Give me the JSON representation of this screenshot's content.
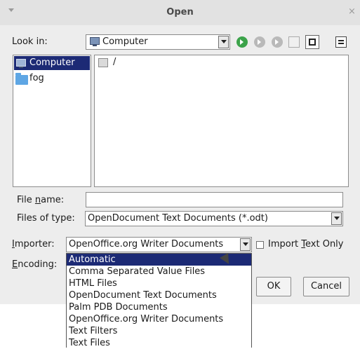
{
  "window": {
    "title": "Open",
    "close_glyph": "×"
  },
  "look_in": {
    "label": "Look in:",
    "value": "Computer",
    "toolbar": [
      "back-icon",
      "forward-icon",
      "up-icon",
      "new-folder-icon",
      "list-view-icon",
      "detail-view-icon"
    ]
  },
  "sidebar": {
    "items": [
      {
        "label": "Computer",
        "icon": "computer-icon",
        "selected": true
      },
      {
        "label": "fog",
        "icon": "folder-icon",
        "selected": false
      }
    ]
  },
  "files": {
    "items": [
      {
        "label": "/",
        "icon": "drive-icon"
      }
    ]
  },
  "file_name": {
    "label_pre": "File ",
    "label_u": "n",
    "label_post": "ame:",
    "value": ""
  },
  "files_of_type": {
    "label": "Files of type:",
    "value": "OpenDocument Text Documents (*.odt)"
  },
  "importer": {
    "label_u": "I",
    "label_post": "mporter:",
    "value": "OpenOffice.org Writer Documents",
    "options": [
      "Automatic",
      "Comma Separated Value Files",
      "HTML Files",
      "OpenDocument Text Documents",
      "Palm PDB Documents",
      "OpenOffice.org Writer Documents",
      "Text Filters",
      "Text Files"
    ],
    "highlighted": "Automatic"
  },
  "import_text_only": {
    "label_pre": "Import ",
    "label_u": "T",
    "label_post": "ext Only",
    "checked": false
  },
  "encoding": {
    "label_u": "E",
    "label_post": "ncoding:"
  },
  "buttons": {
    "ok": "OK",
    "cancel": "Cancel"
  },
  "colors": {
    "selection": "#1c2a75",
    "dialog_bg": "#ededed",
    "nav_green": "#3ca34a"
  }
}
